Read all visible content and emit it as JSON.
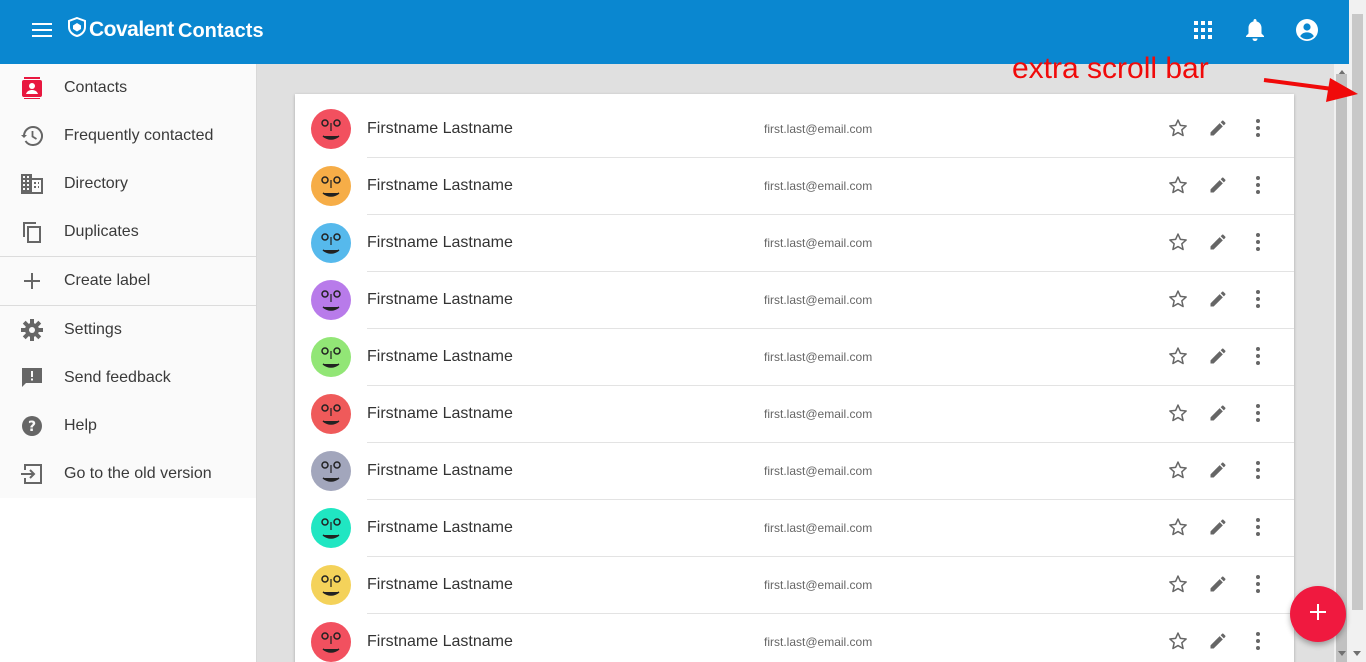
{
  "header": {
    "brand": "Covalent",
    "title": "Contacts",
    "color": "#0a87d0"
  },
  "sidebar": {
    "items": [
      {
        "label": "Contacts",
        "icon": "contacts-icon",
        "active": true
      },
      {
        "label": "Frequently contacted",
        "icon": "history-icon"
      },
      {
        "label": "Directory",
        "icon": "domain-icon"
      },
      {
        "label": "Duplicates",
        "icon": "copy-icon"
      }
    ],
    "create_label": {
      "label": "Create label",
      "icon": "plus-icon"
    },
    "footer_items": [
      {
        "label": "Settings",
        "icon": "gear-icon"
      },
      {
        "label": "Send feedback",
        "icon": "feedback-icon"
      },
      {
        "label": "Help",
        "icon": "help-icon"
      },
      {
        "label": "Go to the old version",
        "icon": "exit-icon"
      }
    ]
  },
  "contacts": [
    {
      "name": "Firstname Lastname",
      "email": "first.last@email.com",
      "avatar_color": "#f2505f"
    },
    {
      "name": "Firstname Lastname",
      "email": "first.last@email.com",
      "avatar_color": "#f6ad47"
    },
    {
      "name": "Firstname Lastname",
      "email": "first.last@email.com",
      "avatar_color": "#56b9ec"
    },
    {
      "name": "Firstname Lastname",
      "email": "first.last@email.com",
      "avatar_color": "#b87bea"
    },
    {
      "name": "Firstname Lastname",
      "email": "first.last@email.com",
      "avatar_color": "#92e676"
    },
    {
      "name": "Firstname Lastname",
      "email": "first.last@email.com",
      "avatar_color": "#ef5a5a"
    },
    {
      "name": "Firstname Lastname",
      "email": "first.last@email.com",
      "avatar_color": "#a2a6bc"
    },
    {
      "name": "Firstname Lastname",
      "email": "first.last@email.com",
      "avatar_color": "#20e6c2"
    },
    {
      "name": "Firstname Lastname",
      "email": "first.last@email.com",
      "avatar_color": "#f4d25a"
    },
    {
      "name": "Firstname Lastname",
      "email": "first.last@email.com",
      "avatar_color": "#f2505f"
    }
  ],
  "fab": {
    "icon": "plus-icon",
    "color": "#f0193f"
  },
  "annotation": {
    "text": "extra scroll bar",
    "color": "#f00a0a"
  }
}
